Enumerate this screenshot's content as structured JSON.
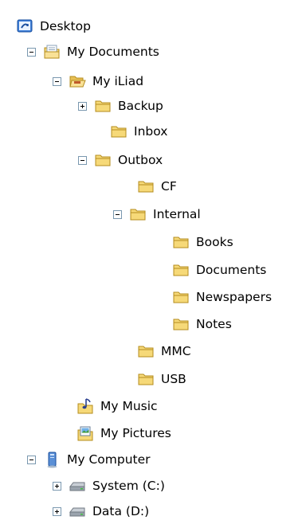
{
  "tree": {
    "desktop": "Desktop",
    "my_documents": "My Documents",
    "my_iliad": "My iLiad",
    "backup": "Backup",
    "inbox": "Inbox",
    "outbox": "Outbox",
    "cf": "CF",
    "internal": "Internal",
    "books": "Books",
    "documents": "Documents",
    "newspapers": "Newspapers",
    "notes": "Notes",
    "mmc": "MMC",
    "usb": "USB",
    "my_music": "My Music",
    "my_pictures": "My Pictures",
    "my_computer": "My Computer",
    "system_c": "System (C:)",
    "data_d": "Data (D:)"
  },
  "icons": {
    "folder": "folder-icon",
    "open_folder": "open-folder-icon",
    "desktop": "desktop-icon",
    "documents": "documents-folder-icon",
    "music": "music-folder-icon",
    "pictures": "pictures-folder-icon",
    "computer": "computer-icon",
    "drive": "drive-icon"
  },
  "colors": {
    "folder_fill": "#f6d978",
    "folder_stroke": "#b48c1e",
    "expander_border": "#7a98af"
  }
}
